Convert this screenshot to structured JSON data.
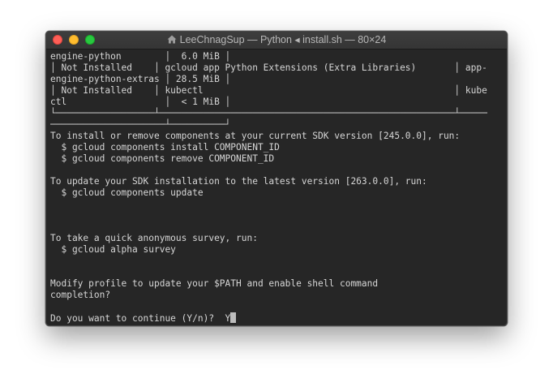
{
  "window": {
    "title": "LeeChnagSup — Python ◂ install.sh — 80×24"
  },
  "terminal": {
    "lines": [
      "engine-python        │  6.0 MiB │",
      "│ Not Installed    │ gcloud app Python Extensions (Extra Libraries)       │ app-",
      "engine-python-extras │ 28.5 MiB │",
      "│ Not Installed    │ kubectl                                              │ kube",
      "ctl                  │  < 1 MiB │",
      "└──────────────────┴──────────────────────────────────────────────────────┴─────",
      "─────────────────────┴──────────┘",
      "To install or remove components at your current SDK version [245.0.0], run:",
      "  $ gcloud components install COMPONENT_ID",
      "  $ gcloud components remove COMPONENT_ID",
      "",
      "To update your SDK installation to the latest version [263.0.0], run:",
      "  $ gcloud components update",
      "",
      "",
      "",
      "To take a quick anonymous survey, run:",
      "  $ gcloud alpha survey",
      "",
      "",
      "Modify profile to update your $PATH and enable shell command",
      "completion?",
      "",
      "Do you want to continue (Y/n)?  Y"
    ]
  }
}
